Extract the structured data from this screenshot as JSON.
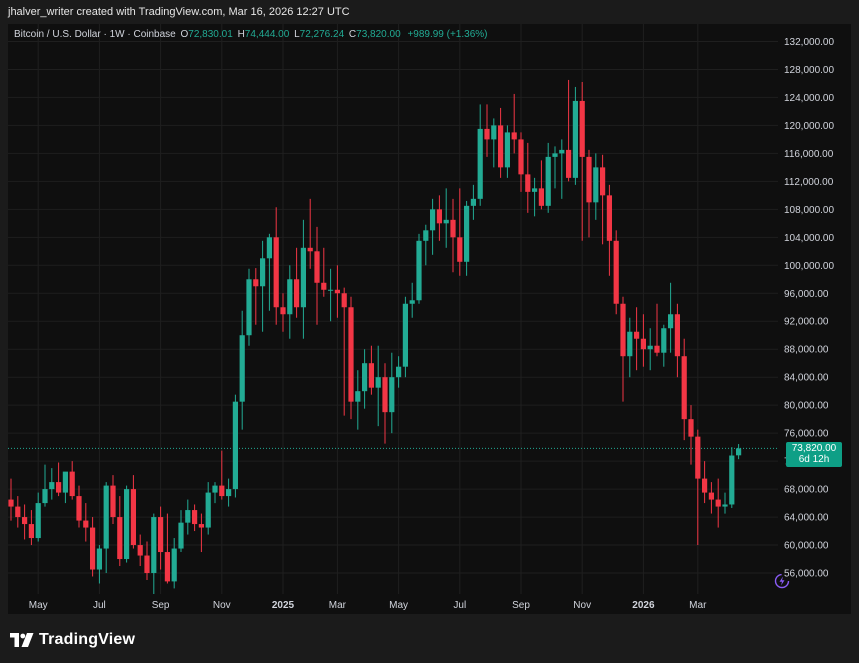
{
  "header": {
    "credit": "jhalver_writer created with TradingView.com, Mar 16, 2026 12:27 UTC"
  },
  "legend": {
    "symbol": "Bitcoin / U.S. Dollar · 1W · Coinbase",
    "open_label": "O",
    "open": "72,830.01",
    "high_label": "H",
    "high": "74,444.00",
    "low_label": "L",
    "low": "72,276.24",
    "close_label": "C",
    "close": "73,820.00",
    "change": "+989.99 (+1.36%)"
  },
  "price_tag": {
    "price": "73,820.00",
    "countdown": "6d 12h"
  },
  "footer": {
    "brand": "TradingView",
    "brand_icon": "tradingview-logo-icon"
  },
  "colors": {
    "up": "#22ab94",
    "down": "#f23645",
    "background": "#0f0f0f",
    "grid": "#1f1f1f",
    "text": "#d1d4dc",
    "ai_icon": "#8a5cf6"
  },
  "chart_data": {
    "type": "candlestick",
    "title": "Bitcoin / U.S. Dollar · 1W · Coinbase",
    "interval": "1W",
    "ylim": [
      53000,
      134500
    ],
    "y_ticks": [
      "132,000.00",
      "128,000.00",
      "124,000.00",
      "120,000.00",
      "116,000.00",
      "112,000.00",
      "108,000.00",
      "104,000.00",
      "100,000.00",
      "96,000.00",
      "92,000.00",
      "88,000.00",
      "84,000.00",
      "80,000.00",
      "76,000.00",
      "72,000.00",
      "68,000.00",
      "64,000.00",
      "60,000.00",
      "56,000.00"
    ],
    "y_tick_values": [
      132000,
      128000,
      124000,
      120000,
      116000,
      112000,
      108000,
      104000,
      100000,
      96000,
      92000,
      88000,
      84000,
      80000,
      76000,
      72000,
      68000,
      64000,
      60000,
      56000
    ],
    "x_ticks": [
      {
        "label": "May",
        "index": 4,
        "bold": false
      },
      {
        "label": "Jul",
        "index": 13,
        "bold": false
      },
      {
        "label": "Sep",
        "index": 22,
        "bold": false
      },
      {
        "label": "Nov",
        "index": 31,
        "bold": false
      },
      {
        "label": "2025",
        "index": 40,
        "bold": true
      },
      {
        "label": "Mar",
        "index": 48,
        "bold": false
      },
      {
        "label": "May",
        "index": 57,
        "bold": false
      },
      {
        "label": "Jul",
        "index": 66,
        "bold": false
      },
      {
        "label": "Sep",
        "index": 75,
        "bold": false
      },
      {
        "label": "Nov",
        "index": 84,
        "bold": false
      },
      {
        "label": "2026",
        "index": 93,
        "bold": true
      },
      {
        "label": "Mar",
        "index": 101,
        "bold": false
      }
    ],
    "last_price": 73820,
    "candles": [
      {
        "o": 66500,
        "h": 69500,
        "l": 63500,
        "c": 65500
      },
      {
        "o": 65500,
        "h": 67000,
        "l": 62500,
        "c": 64000
      },
      {
        "o": 64000,
        "h": 65800,
        "l": 60800,
        "c": 63000
      },
      {
        "o": 63000,
        "h": 65000,
        "l": 60000,
        "c": 61000
      },
      {
        "o": 61000,
        "h": 67500,
        "l": 60500,
        "c": 66000
      },
      {
        "o": 66000,
        "h": 71500,
        "l": 65500,
        "c": 68000
      },
      {
        "o": 68000,
        "h": 71000,
        "l": 66500,
        "c": 69000
      },
      {
        "o": 69000,
        "h": 71800,
        "l": 67000,
        "c": 67500
      },
      {
        "o": 67500,
        "h": 70000,
        "l": 66000,
        "c": 70500
      },
      {
        "o": 70500,
        "h": 72000,
        "l": 66500,
        "c": 67000
      },
      {
        "o": 67000,
        "h": 68500,
        "l": 62500,
        "c": 63500
      },
      {
        "o": 63500,
        "h": 66000,
        "l": 60500,
        "c": 62500
      },
      {
        "o": 62500,
        "h": 64000,
        "l": 55500,
        "c": 56500
      },
      {
        "o": 56500,
        "h": 60000,
        "l": 54500,
        "c": 59500
      },
      {
        "o": 59500,
        "h": 69000,
        "l": 56000,
        "c": 68500
      },
      {
        "o": 68500,
        "h": 70000,
        "l": 63000,
        "c": 64000
      },
      {
        "o": 64000,
        "h": 67000,
        "l": 57000,
        "c": 58000
      },
      {
        "o": 58000,
        "h": 68500,
        "l": 57500,
        "c": 68000
      },
      {
        "o": 68000,
        "h": 70000,
        "l": 59500,
        "c": 60000
      },
      {
        "o": 60000,
        "h": 61500,
        "l": 57000,
        "c": 58500
      },
      {
        "o": 58500,
        "h": 60500,
        "l": 55000,
        "c": 56000
      },
      {
        "o": 56000,
        "h": 64500,
        "l": 53000,
        "c": 64000
      },
      {
        "o": 64000,
        "h": 65500,
        "l": 56500,
        "c": 59000
      },
      {
        "o": 59000,
        "h": 64500,
        "l": 54500,
        "c": 54800
      },
      {
        "o": 54800,
        "h": 61000,
        "l": 53800,
        "c": 59500
      },
      {
        "o": 59500,
        "h": 65000,
        "l": 59000,
        "c": 63200
      },
      {
        "o": 63200,
        "h": 66500,
        "l": 61500,
        "c": 65000
      },
      {
        "o": 65000,
        "h": 65800,
        "l": 62000,
        "c": 63000
      },
      {
        "o": 63000,
        "h": 64500,
        "l": 59000,
        "c": 62500
      },
      {
        "o": 62500,
        "h": 69000,
        "l": 61500,
        "c": 67500
      },
      {
        "o": 67500,
        "h": 69000,
        "l": 66000,
        "c": 68500
      },
      {
        "o": 68500,
        "h": 73500,
        "l": 66500,
        "c": 67000
      },
      {
        "o": 67000,
        "h": 69500,
        "l": 65500,
        "c": 68000
      },
      {
        "o": 68000,
        "h": 81500,
        "l": 66800,
        "c": 80500
      },
      {
        "o": 80500,
        "h": 93500,
        "l": 76500,
        "c": 90000
      },
      {
        "o": 90000,
        "h": 99500,
        "l": 88500,
        "c": 98000
      },
      {
        "o": 98000,
        "h": 99600,
        "l": 91500,
        "c": 97000
      },
      {
        "o": 97000,
        "h": 103500,
        "l": 90500,
        "c": 101000
      },
      {
        "o": 101000,
        "h": 104500,
        "l": 93500,
        "c": 104000
      },
      {
        "o": 104000,
        "h": 108300,
        "l": 91500,
        "c": 94000
      },
      {
        "o": 94000,
        "h": 96000,
        "l": 90500,
        "c": 93000
      },
      {
        "o": 93000,
        "h": 100000,
        "l": 89500,
        "c": 98000
      },
      {
        "o": 98000,
        "h": 102500,
        "l": 92500,
        "c": 94000
      },
      {
        "o": 94000,
        "h": 106500,
        "l": 89500,
        "c": 102500
      },
      {
        "o": 102500,
        "h": 109500,
        "l": 99500,
        "c": 102000
      },
      {
        "o": 102000,
        "h": 105500,
        "l": 91500,
        "c": 97500
      },
      {
        "o": 97500,
        "h": 102500,
        "l": 95500,
        "c": 96500
      },
      {
        "o": 96500,
        "h": 99500,
        "l": 92000,
        "c": 96500
      },
      {
        "o": 96500,
        "h": 100000,
        "l": 92500,
        "c": 96000
      },
      {
        "o": 96000,
        "h": 96800,
        "l": 78500,
        "c": 94000
      },
      {
        "o": 94000,
        "h": 95500,
        "l": 78000,
        "c": 80500
      },
      {
        "o": 80500,
        "h": 85000,
        "l": 76500,
        "c": 82000
      },
      {
        "o": 82000,
        "h": 88000,
        "l": 79500,
        "c": 86000
      },
      {
        "o": 86000,
        "h": 88500,
        "l": 81500,
        "c": 82500
      },
      {
        "o": 82500,
        "h": 88500,
        "l": 77000,
        "c": 84000
      },
      {
        "o": 84000,
        "h": 86000,
        "l": 74500,
        "c": 79000
      },
      {
        "o": 79000,
        "h": 87500,
        "l": 76000,
        "c": 84000
      },
      {
        "o": 84000,
        "h": 87000,
        "l": 82500,
        "c": 85500
      },
      {
        "o": 85500,
        "h": 95500,
        "l": 84000,
        "c": 94500
      },
      {
        "o": 94500,
        "h": 97500,
        "l": 92500,
        "c": 95000
      },
      {
        "o": 95000,
        "h": 104500,
        "l": 94500,
        "c": 103500
      },
      {
        "o": 103500,
        "h": 105800,
        "l": 100000,
        "c": 105000
      },
      {
        "o": 105000,
        "h": 109500,
        "l": 101500,
        "c": 108000
      },
      {
        "o": 108000,
        "h": 110000,
        "l": 103500,
        "c": 106000
      },
      {
        "o": 106000,
        "h": 111000,
        "l": 102500,
        "c": 106500
      },
      {
        "o": 106500,
        "h": 109500,
        "l": 99000,
        "c": 104000
      },
      {
        "o": 104000,
        "h": 111000,
        "l": 98500,
        "c": 100500
      },
      {
        "o": 100500,
        "h": 109200,
        "l": 98500,
        "c": 108500
      },
      {
        "o": 108500,
        "h": 111500,
        "l": 106500,
        "c": 109500
      },
      {
        "o": 109500,
        "h": 123000,
        "l": 108500,
        "c": 119500
      },
      {
        "o": 119500,
        "h": 123000,
        "l": 115500,
        "c": 118000
      },
      {
        "o": 118000,
        "h": 121000,
        "l": 114000,
        "c": 120000
      },
      {
        "o": 120000,
        "h": 122500,
        "l": 112500,
        "c": 114000
      },
      {
        "o": 114000,
        "h": 120000,
        "l": 112500,
        "c": 119000
      },
      {
        "o": 119000,
        "h": 124500,
        "l": 116000,
        "c": 118000
      },
      {
        "o": 118000,
        "h": 119000,
        "l": 110500,
        "c": 113000
      },
      {
        "o": 113000,
        "h": 117500,
        "l": 107500,
        "c": 110500
      },
      {
        "o": 110500,
        "h": 112500,
        "l": 107000,
        "c": 111000
      },
      {
        "o": 111000,
        "h": 115000,
        "l": 108000,
        "c": 108500
      },
      {
        "o": 108500,
        "h": 117500,
        "l": 107500,
        "c": 115500
      },
      {
        "o": 115500,
        "h": 117000,
        "l": 111000,
        "c": 116000
      },
      {
        "o": 116000,
        "h": 118000,
        "l": 109500,
        "c": 116500
      },
      {
        "o": 116500,
        "h": 126500,
        "l": 112000,
        "c": 112500
      },
      {
        "o": 112500,
        "h": 125500,
        "l": 111500,
        "c": 123500
      },
      {
        "o": 123500,
        "h": 126200,
        "l": 103500,
        "c": 115500
      },
      {
        "o": 115500,
        "h": 116500,
        "l": 104000,
        "c": 109000
      },
      {
        "o": 109000,
        "h": 116000,
        "l": 106500,
        "c": 114000
      },
      {
        "o": 114000,
        "h": 115800,
        "l": 103000,
        "c": 110000
      },
      {
        "o": 110000,
        "h": 111500,
        "l": 98500,
        "c": 103500
      },
      {
        "o": 103500,
        "h": 105000,
        "l": 93000,
        "c": 94500
      },
      {
        "o": 94500,
        "h": 95500,
        "l": 80500,
        "c": 87000
      },
      {
        "o": 87000,
        "h": 92500,
        "l": 84000,
        "c": 90500
      },
      {
        "o": 90500,
        "h": 94000,
        "l": 85000,
        "c": 89500
      },
      {
        "o": 89500,
        "h": 93000,
        "l": 85500,
        "c": 88000
      },
      {
        "o": 88000,
        "h": 91000,
        "l": 85000,
        "c": 88500
      },
      {
        "o": 88500,
        "h": 94500,
        "l": 87000,
        "c": 87500
      },
      {
        "o": 87500,
        "h": 91500,
        "l": 85500,
        "c": 91000
      },
      {
        "o": 91000,
        "h": 97500,
        "l": 87500,
        "c": 93000
      },
      {
        "o": 93000,
        "h": 94500,
        "l": 84000,
        "c": 87000
      },
      {
        "o": 87000,
        "h": 89500,
        "l": 75000,
        "c": 78000
      },
      {
        "o": 78000,
        "h": 80000,
        "l": 71500,
        "c": 75500
      },
      {
        "o": 75500,
        "h": 76500,
        "l": 60000,
        "c": 69500
      },
      {
        "o": 69500,
        "h": 72000,
        "l": 66000,
        "c": 67500
      },
      {
        "o": 67500,
        "h": 69000,
        "l": 64500,
        "c": 66500
      },
      {
        "o": 66500,
        "h": 69500,
        "l": 62500,
        "c": 65500
      },
      {
        "o": 65500,
        "h": 67500,
        "l": 64500,
        "c": 65800
      },
      {
        "o": 65800,
        "h": 74000,
        "l": 65300,
        "c": 72800
      },
      {
        "o": 72830.01,
        "h": 74444,
        "l": 72276.24,
        "c": 73820
      }
    ]
  }
}
